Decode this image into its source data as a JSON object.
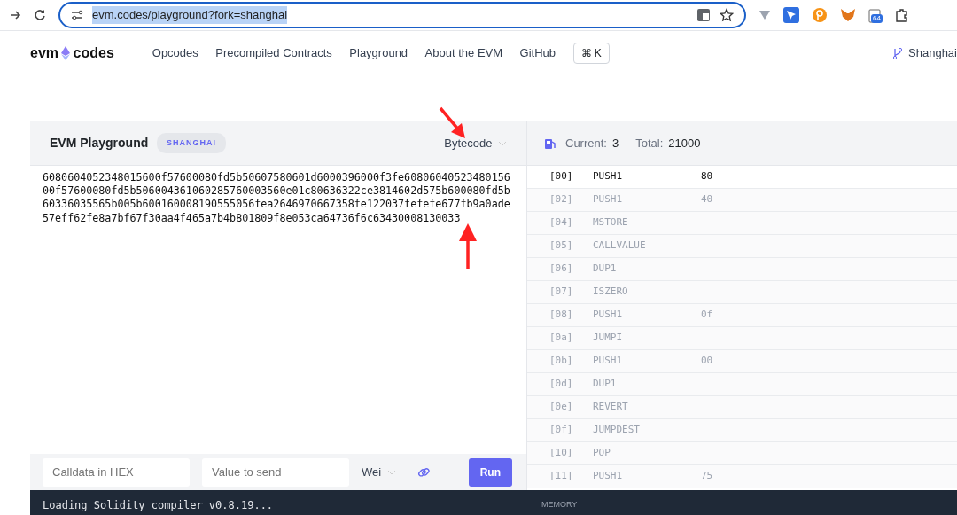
{
  "browser": {
    "url": "evm.codes/playground?fork=shanghai",
    "extension_badge": "64"
  },
  "nav": {
    "logo_left": "evm",
    "logo_right": "codes",
    "links": [
      "Opcodes",
      "Precompiled Contracts",
      "Playground",
      "About the EVM",
      "GitHub"
    ],
    "shortcut": "⌘ K",
    "fork": "Shanghai"
  },
  "editor": {
    "title": "EVM Playground",
    "fork_badge": "SHANGHAI",
    "mode": "Bytecode",
    "code": "6080604052348015600f57600080fd5b50607580601d6000396000f3fe6080604052348015600f57600080fd5b506004361060285760003560e01c80636322ce3814602d575b600080fd5b60336035565b005b600160008190555056fea2646970667358fe122037fefefe677fb9a0ade57eff62fe8a7bf67f30aa4f465a7b4b801809f8e053ca64736f6c63430008130033",
    "calldata_placeholder": "Calldata in HEX",
    "value_placeholder": "Value to send",
    "unit": "Wei",
    "run": "Run",
    "console": "Loading Solidity compiler v0.8.19..."
  },
  "gas": {
    "current_label": "Current:",
    "current": "3",
    "total_label": "Total:",
    "total": "21000"
  },
  "opcodes": [
    {
      "offset": "[00]",
      "name": "PUSH1",
      "arg": "80",
      "selected": true
    },
    {
      "offset": "[02]",
      "name": "PUSH1",
      "arg": "40",
      "selected": false
    },
    {
      "offset": "[04]",
      "name": "MSTORE",
      "selected": false
    },
    {
      "offset": "[05]",
      "name": "CALLVALUE",
      "selected": false
    },
    {
      "offset": "[06]",
      "name": "DUP1",
      "selected": false
    },
    {
      "offset": "[07]",
      "name": "ISZERO",
      "selected": false
    },
    {
      "offset": "[08]",
      "name": "PUSH1",
      "arg": "0f",
      "selected": false
    },
    {
      "offset": "[0a]",
      "name": "JUMPI",
      "selected": false
    },
    {
      "offset": "[0b]",
      "name": "PUSH1",
      "arg": "00",
      "selected": false
    },
    {
      "offset": "[0d]",
      "name": "DUP1",
      "selected": false
    },
    {
      "offset": "[0e]",
      "name": "REVERT",
      "selected": false
    },
    {
      "offset": "[0f]",
      "name": "JUMPDEST",
      "selected": false
    },
    {
      "offset": "[10]",
      "name": "POP",
      "selected": false
    },
    {
      "offset": "[11]",
      "name": "PUSH1",
      "arg": "75",
      "selected": false
    }
  ],
  "memory_label": "MEMORY"
}
